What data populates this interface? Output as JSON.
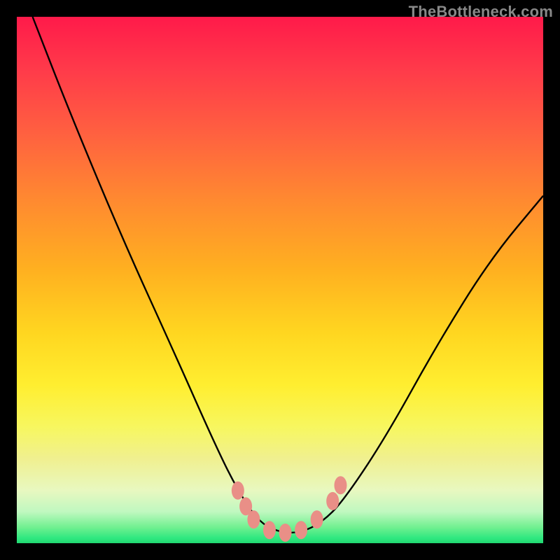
{
  "watermark": "TheBottleneck.com",
  "chart_data": {
    "type": "line",
    "title": "",
    "xlabel": "",
    "ylabel": "",
    "xlim": [
      0,
      100
    ],
    "ylim": [
      0,
      100
    ],
    "series": [
      {
        "name": "bottleneck-curve",
        "x": [
          3,
          10,
          20,
          30,
          38,
          42,
          46,
          50,
          54,
          58,
          62,
          70,
          80,
          90,
          100
        ],
        "values": [
          100,
          82,
          58,
          36,
          18,
          10,
          4,
          2,
          2,
          4,
          8,
          20,
          38,
          54,
          66
        ]
      }
    ],
    "markers": {
      "name": "flat-bottom-cluster",
      "color": "#e98f87",
      "points": [
        {
          "x": 42,
          "y": 10
        },
        {
          "x": 43.5,
          "y": 7
        },
        {
          "x": 45,
          "y": 4.5
        },
        {
          "x": 48,
          "y": 2.5
        },
        {
          "x": 51,
          "y": 2
        },
        {
          "x": 54,
          "y": 2.5
        },
        {
          "x": 57,
          "y": 4.5
        },
        {
          "x": 60,
          "y": 8
        },
        {
          "x": 61.5,
          "y": 11
        }
      ]
    },
    "background_gradient": {
      "top": "#ff1a4a",
      "mid": "#ffee30",
      "bottom": "#20d870"
    }
  }
}
